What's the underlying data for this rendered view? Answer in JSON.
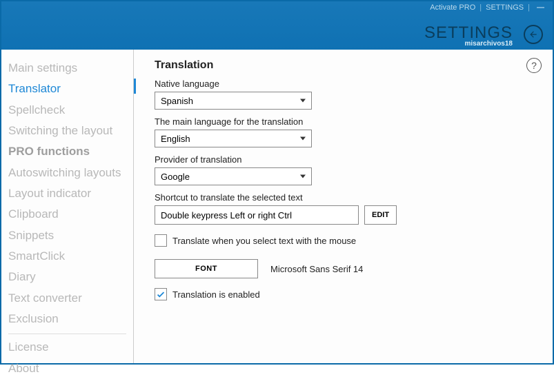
{
  "header": {
    "activate": "Activate PRO",
    "settings_link": "SETTINGS",
    "title": "SETTINGS",
    "username": "misarchivos18"
  },
  "sidebar": {
    "items": [
      {
        "label": "Main settings",
        "active": false
      },
      {
        "label": "Translator",
        "active": true
      },
      {
        "label": "Spellcheck",
        "active": false
      },
      {
        "label": "Switching the layout",
        "active": false
      },
      {
        "label": "PRO functions",
        "active": false,
        "bold": true
      },
      {
        "label": "Autoswitching layouts",
        "active": false
      },
      {
        "label": "Layout indicator",
        "active": false
      },
      {
        "label": "Clipboard",
        "active": false
      },
      {
        "label": "Snippets",
        "active": false
      },
      {
        "label": "SmartClick",
        "active": false
      },
      {
        "label": "Diary",
        "active": false
      },
      {
        "label": "Text converter",
        "active": false
      },
      {
        "label": "Exclusion",
        "active": false
      }
    ],
    "bottom": [
      {
        "label": "License"
      },
      {
        "label": "About"
      }
    ]
  },
  "content": {
    "heading": "Translation",
    "native_label": "Native language",
    "native_value": "Spanish",
    "main_label": "The main language for the translation",
    "main_value": "English",
    "provider_label": "Provider of translation",
    "provider_value": "Google",
    "shortcut_label": "Shortcut to translate the selected text",
    "shortcut_value": "Double keypress Left or right Ctrl",
    "edit_btn": "EDIT",
    "translate_mouse_label": "Translate when you select text with the mouse",
    "translate_mouse_checked": false,
    "font_btn": "FONT",
    "font_label": "Microsoft Sans Serif 14",
    "enabled_label": "Translation is enabled",
    "enabled_checked": true,
    "help": "?"
  }
}
